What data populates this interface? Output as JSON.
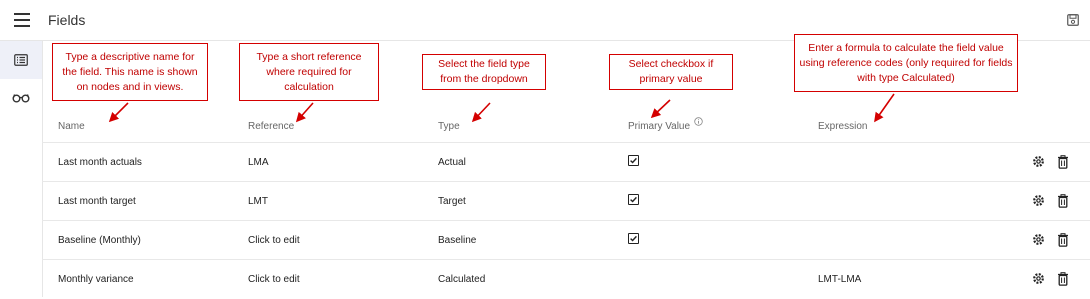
{
  "header": {
    "title": "Fields"
  },
  "columns": {
    "name": "Name",
    "reference": "Reference",
    "type": "Type",
    "primary": "Primary Value",
    "expression": "Expression"
  },
  "rows": [
    {
      "name": "Last month actuals",
      "reference": "LMA",
      "type": "Actual",
      "primary": true,
      "expression": ""
    },
    {
      "name": "Last month target",
      "reference": "LMT",
      "type": "Target",
      "primary": true,
      "expression": ""
    },
    {
      "name": "Baseline (Monthly)",
      "reference": "Click to edit",
      "type": "Baseline",
      "primary": true,
      "expression": ""
    },
    {
      "name": "Monthly variance",
      "reference": "Click to edit",
      "type": "Calculated",
      "primary": false,
      "expression": "LMT-LMA"
    }
  ],
  "callouts": {
    "name": "Type a descriptive name for the field. This name is shown on nodes and in views.",
    "reference": "Type a short reference where required for calculation",
    "type": "Select the field type from the dropdown",
    "primary": "Select checkbox if primary value",
    "expression": "Enter a formula to calculate the field value using reference codes (only required for fields with type Calculated)"
  },
  "icons": {
    "menu": "menu-icon",
    "save": "save-icon",
    "list": "list-icon",
    "glasses": "glasses-icon",
    "info": "info-icon",
    "settings": "gear-icon",
    "delete": "trash-icon"
  },
  "colors": {
    "annotation": "#d40000",
    "active_nav": "#eef0f8"
  }
}
